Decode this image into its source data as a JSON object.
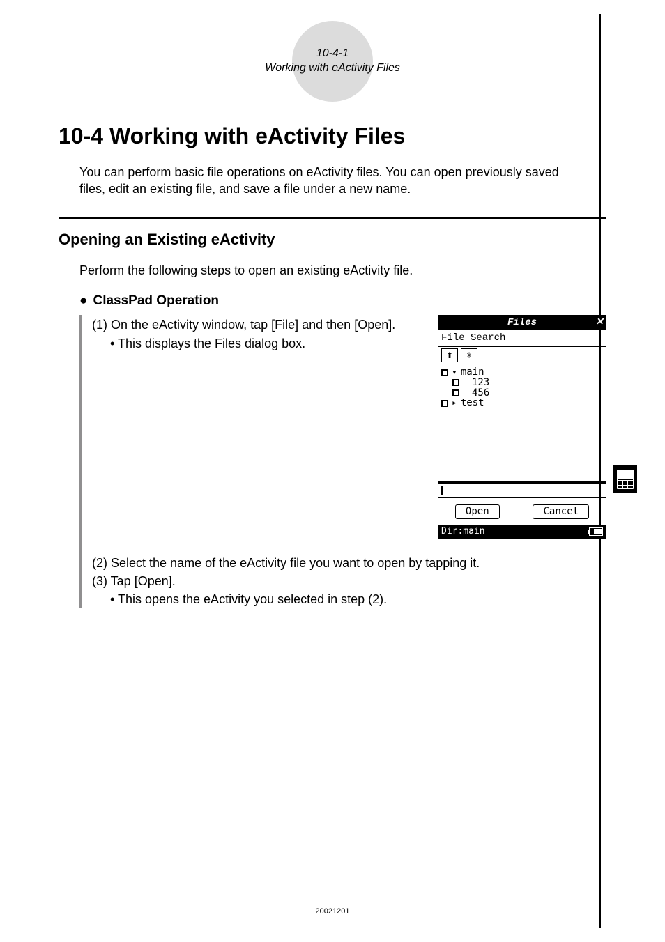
{
  "header": {
    "section_number": "10-4-1",
    "section_name": "Working with eActivity Files"
  },
  "title": "10-4 Working with eActivity Files",
  "intro": "You can perform basic file operations on eActivity files. You can open previously saved files, edit an existing file, and save a file under a new name.",
  "sub_heading": "Opening an Existing eActivity",
  "sub_intro": "Perform the following steps to open an existing eActivity file.",
  "operation_label": "ClassPad Operation",
  "steps": {
    "s1": "(1) On the eActivity window, tap [File] and then [Open].",
    "s1_bullet": "• This displays the Files dialog box.",
    "s2": "(2) Select the name of the eActivity file you want to open by tapping it.",
    "s3": "(3) Tap [Open].",
    "s3_bullet": "• This opens the eActivity you selected in step (2)."
  },
  "dialog": {
    "title": "Files",
    "menu": "File Search",
    "tree": {
      "main": "main",
      "item1": "123",
      "item2": "456",
      "test": "test"
    },
    "open": "Open",
    "cancel": "Cancel",
    "status": "Dir:main"
  },
  "footer_date": "20021201"
}
